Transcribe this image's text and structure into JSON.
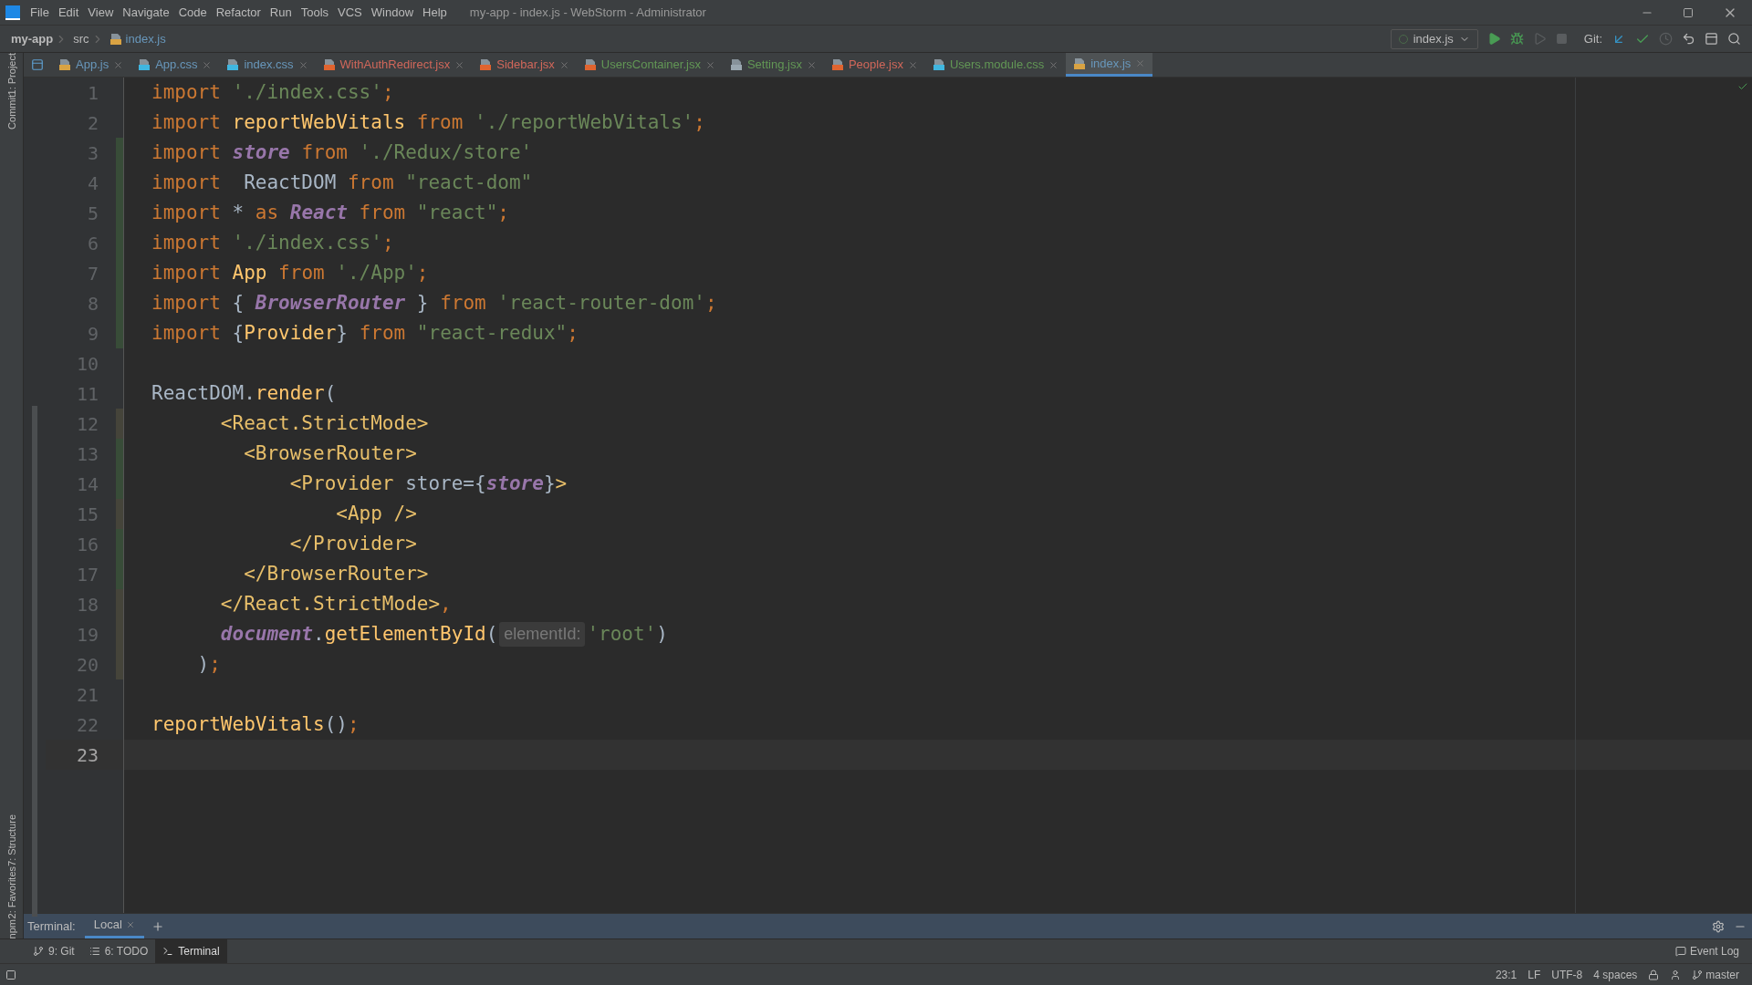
{
  "title_bar": {
    "menu": [
      "File",
      "Edit",
      "View",
      "Navigate",
      "Code",
      "Refactor",
      "Run",
      "Tools",
      "VCS",
      "Window",
      "Help"
    ],
    "title": "my-app - index.js - WebStorm - Administrator"
  },
  "nav_bar": {
    "breadcrumbs": [
      "my-app",
      "src",
      "index.js"
    ],
    "run_config": "index.js",
    "git_label": "Git:"
  },
  "tabs": [
    {
      "label": "App.js",
      "kind": "js",
      "color": "#6897bb",
      "selected": false
    },
    {
      "label": "App.css",
      "kind": "css",
      "color": "#6897bb",
      "selected": false
    },
    {
      "label": "index.css",
      "kind": "css",
      "color": "#6897bb",
      "selected": false
    },
    {
      "label": "WithAuthRedirect.jsx",
      "kind": "jsx",
      "color": "#d1675a",
      "selected": false
    },
    {
      "label": "Sidebar.jsx",
      "kind": "jsx",
      "color": "#d1675a",
      "selected": false
    },
    {
      "label": "UsersContainer.jsx",
      "kind": "jsx",
      "color": "#629755",
      "selected": false
    },
    {
      "label": "Setting.jsx",
      "kind": "other",
      "color": "#629755",
      "selected": false
    },
    {
      "label": "People.jsx",
      "kind": "jsx",
      "color": "#d1675a",
      "selected": false
    },
    {
      "label": "Users.module.css",
      "kind": "css",
      "color": "#629755",
      "selected": false
    },
    {
      "label": "index.js",
      "kind": "js",
      "color": "#6897bb",
      "selected": true
    }
  ],
  "side_tabs_top": [
    "1: Project",
    "Commit"
  ],
  "side_tabs_bottom": [
    "7: Structure",
    "2: Favorites",
    "npm"
  ],
  "editor": {
    "lines": [
      {
        "number": "1",
        "current": false,
        "tokens": [
          {
            "kind": "kw",
            "text": "import "
          },
          {
            "kind": "str",
            "text": "'./index.css'"
          },
          {
            "kind": "semi",
            "text": ";"
          }
        ]
      },
      {
        "number": "2",
        "current": false,
        "tokens": [
          {
            "kind": "kw",
            "text": "import "
          },
          {
            "kind": "id",
            "text": "reportWebVitals"
          },
          {
            "kind": "kw",
            "text": " from "
          },
          {
            "kind": "str",
            "text": "'./reportWebVitals'"
          },
          {
            "kind": "semi",
            "text": ";"
          }
        ]
      },
      {
        "number": "3",
        "current": false,
        "color": "#384c38",
        "tokens": [
          {
            "kind": "kw",
            "text": "import "
          },
          {
            "kind": "var",
            "text": "store"
          },
          {
            "kind": "kw",
            "text": " from "
          },
          {
            "kind": "str",
            "text": "'./Redux/store'"
          }
        ]
      },
      {
        "number": "4",
        "current": false,
        "color": "#384c38",
        "tokens": [
          {
            "kind": "kw",
            "text": "import  "
          },
          {
            "kind": "plain",
            "text": "ReactDOM"
          },
          {
            "kind": "kw",
            "text": " from "
          },
          {
            "kind": "str",
            "text": "\"react-dom\""
          }
        ]
      },
      {
        "number": "5",
        "current": false,
        "color": "#384c38",
        "tokens": [
          {
            "kind": "kw",
            "text": "import "
          },
          {
            "kind": "plain",
            "text": "* "
          },
          {
            "kind": "kw",
            "text": "as "
          },
          {
            "kind": "var",
            "text": "React"
          },
          {
            "kind": "kw",
            "text": " from "
          },
          {
            "kind": "str",
            "text": "\"react\""
          },
          {
            "kind": "semi",
            "text": ";"
          }
        ]
      },
      {
        "number": "6",
        "current": false,
        "color": "#384c38",
        "tokens": [
          {
            "kind": "kw",
            "text": "import "
          },
          {
            "kind": "str",
            "text": "'./index.css'"
          },
          {
            "kind": "semi",
            "text": ";"
          }
        ]
      },
      {
        "number": "7",
        "current": false,
        "color": "#384c38",
        "tokens": [
          {
            "kind": "kw",
            "text": "import "
          },
          {
            "kind": "id",
            "text": "App"
          },
          {
            "kind": "kw",
            "text": " from "
          },
          {
            "kind": "str",
            "text": "'./App'"
          },
          {
            "kind": "semi",
            "text": ";"
          }
        ]
      },
      {
        "number": "8",
        "current": false,
        "color": "#384c38",
        "tokens": [
          {
            "kind": "kw",
            "text": "import "
          },
          {
            "kind": "plain",
            "text": "{ "
          },
          {
            "kind": "var",
            "text": "BrowserRouter"
          },
          {
            "kind": "plain",
            "text": " } "
          },
          {
            "kind": "kw",
            "text": "from "
          },
          {
            "kind": "str",
            "text": "'react-router-dom'"
          },
          {
            "kind": "semi",
            "text": ";"
          }
        ]
      },
      {
        "number": "9",
        "current": false,
        "color": "#384c38",
        "tokens": [
          {
            "kind": "kw",
            "text": "import "
          },
          {
            "kind": "plain",
            "text": "{"
          },
          {
            "kind": "id",
            "text": "Provider"
          },
          {
            "kind": "plain",
            "text": "} "
          },
          {
            "kind": "kw",
            "text": "from "
          },
          {
            "kind": "str",
            "text": "\"react-redux\""
          },
          {
            "kind": "semi",
            "text": ";"
          }
        ]
      },
      {
        "number": "10",
        "current": false
      },
      {
        "number": "11",
        "current": false,
        "tokens": [
          {
            "kind": "plain",
            "text": "ReactDOM."
          },
          {
            "kind": "id",
            "text": "render"
          },
          {
            "kind": "plain",
            "text": "("
          }
        ]
      },
      {
        "number": "12",
        "current": false,
        "color": "#45443a",
        "tokens": [
          {
            "kind": "tag",
            "text": "      <React.StrictMode>"
          }
        ]
      },
      {
        "number": "13",
        "current": false,
        "color": "#384c38",
        "tokens": [
          {
            "kind": "tag",
            "text": "        <BrowserRouter>"
          }
        ]
      },
      {
        "number": "14",
        "current": false,
        "color": "#384c38",
        "tokens": [
          {
            "kind": "tag",
            "text": "            <Provider "
          },
          {
            "kind": "plain",
            "text": "store={"
          },
          {
            "kind": "var",
            "text": "store"
          },
          {
            "kind": "plain",
            "text": "}"
          },
          {
            "kind": "tag",
            "text": ">"
          }
        ]
      },
      {
        "number": "15",
        "current": false,
        "color": "#45443a",
        "tokens": [
          {
            "kind": "tag",
            "text": "                <App />"
          }
        ]
      },
      {
        "number": "16",
        "current": false,
        "color": "#384c38",
        "tokens": [
          {
            "kind": "tag",
            "text": "            </Provider>"
          }
        ]
      },
      {
        "number": "17",
        "current": false,
        "color": "#384c38",
        "tokens": [
          {
            "kind": "tag",
            "text": "        </BrowserRouter>"
          }
        ]
      },
      {
        "number": "18",
        "current": false,
        "color": "#45443a",
        "tokens": [
          {
            "kind": "tag",
            "text": "      </React.StrictMode>"
          },
          {
            "kind": "semi",
            "text": ","
          }
        ]
      },
      {
        "number": "19",
        "current": false,
        "color": "#45443a",
        "tokens": [
          {
            "kind": "var",
            "text": "      document"
          },
          {
            "kind": "plain",
            "text": "."
          },
          {
            "kind": "id",
            "text": "getElementById"
          },
          {
            "kind": "plain",
            "text": "("
          },
          {
            "kind": "hint",
            "text": "elementId:"
          },
          {
            "kind": "str",
            "text": "'root'"
          },
          {
            "kind": "plain",
            "text": ")"
          }
        ]
      },
      {
        "number": "20",
        "current": false,
        "color": "#45443a",
        "tokens": [
          {
            "kind": "plain",
            "text": "    )"
          },
          {
            "kind": "semi",
            "text": ";"
          }
        ]
      },
      {
        "number": "21",
        "current": false
      },
      {
        "number": "22",
        "current": false,
        "tokens": [
          {
            "kind": "id",
            "text": "reportWebVitals"
          },
          {
            "kind": "plain",
            "text": "()"
          },
          {
            "kind": "semi",
            "text": ";"
          }
        ]
      },
      {
        "number": "23",
        "current": true
      }
    ]
  },
  "terminal": {
    "label": "Terminal:",
    "tabs": [
      {
        "label": "Local",
        "selected": true
      }
    ]
  },
  "tool_windows": [
    {
      "label": "9: Git",
      "kind": "git",
      "selected": false
    },
    {
      "label": "6: TODO",
      "kind": "todo",
      "selected": false
    },
    {
      "label": "Terminal",
      "kind": "terminal",
      "selected": true
    }
  ],
  "event_log": "Event Log",
  "status_bar": [
    "23:1",
    "LF",
    "UTF-8",
    "4 spaces"
  ],
  "branch": "master"
}
